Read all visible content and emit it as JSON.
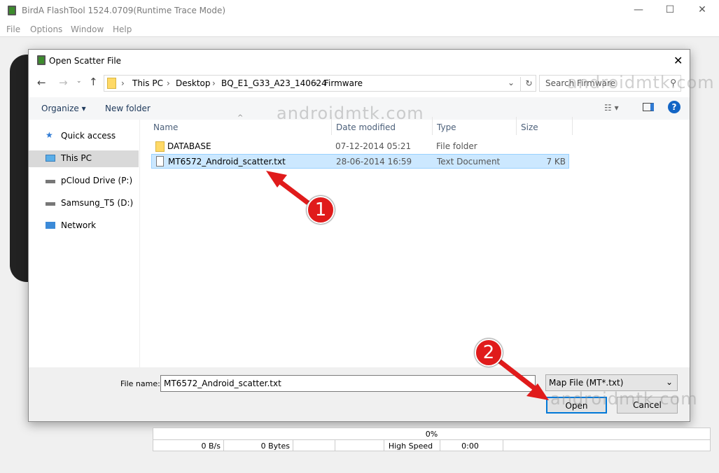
{
  "app": {
    "title": "BirdA FlashTool 1524.0709(Runtime Trace Mode)",
    "menu": [
      "File",
      "Options",
      "Window",
      "Help"
    ]
  },
  "dialog": {
    "title": "Open Scatter File",
    "breadcrumb": [
      "This PC",
      "Desktop",
      "BQ_E1_G33_A23_140624",
      "Firmware"
    ],
    "search_placeholder": "Search Firmware",
    "organize": "Organize",
    "new_folder": "New folder",
    "nav": [
      "Quick access",
      "This PC",
      "pCloud Drive (P:)",
      "Samsung_T5 (D:)",
      "Network"
    ],
    "nav_selected": "This PC",
    "columns": [
      "Name",
      "Date modified",
      "Type",
      "Size"
    ],
    "files": [
      {
        "name": "DATABASE",
        "date": "07-12-2014 05:21",
        "type": "File folder",
        "size": "",
        "icon": "folder-icon"
      },
      {
        "name": "MT6572_Android_scatter.txt",
        "date": "28-06-2014 16:59",
        "type": "Text Document",
        "size": "7 KB",
        "icon": "text-file-icon",
        "selected": true
      }
    ],
    "file_name_label": "File name:",
    "file_name_value": "MT6572_Android_scatter.txt",
    "file_type": "Map File (MT*.txt)",
    "open": "Open",
    "cancel": "Cancel"
  },
  "status": {
    "progress": "0%",
    "speed": "0 B/s",
    "bytes": "0 Bytes",
    "mode": "High Speed",
    "time": "0:00"
  },
  "annotations": {
    "step1": "1",
    "step2": "2",
    "watermark": "androidmtk.com"
  },
  "colors": {
    "selection": "#cce8ff",
    "accent": "#0078d7",
    "arrow": "#e01b1b"
  }
}
